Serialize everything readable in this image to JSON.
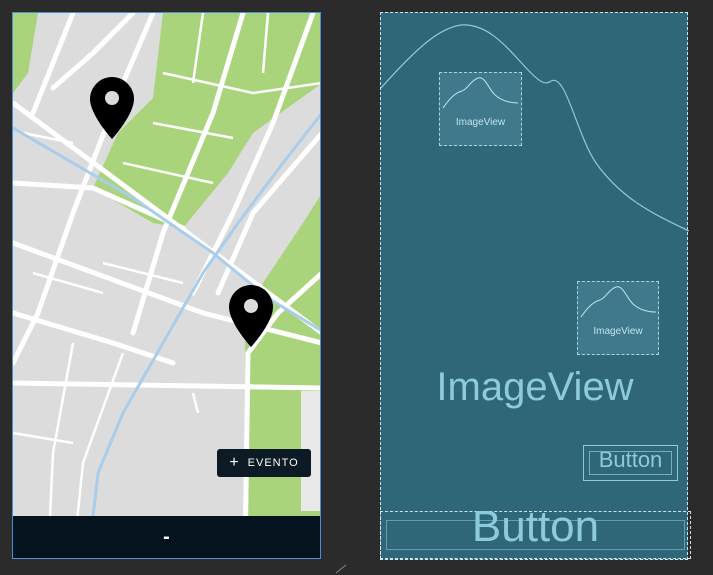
{
  "design_preview": {
    "event_button": {
      "icon": "plus-icon",
      "label": "EVENTO"
    },
    "bottom_bar": {
      "label": "-"
    },
    "map": {
      "pins": [
        "map-pin-icon",
        "map-pin-icon"
      ]
    },
    "colors": {
      "map_background": "#dcdcdc",
      "park": "#a9d47b",
      "river": "#a9cdea",
      "bar": "#04131e"
    }
  },
  "blueprint_preview": {
    "imageview_small_1": "ImageView",
    "imageview_small_2": "ImageView",
    "imageview_center": "ImageView",
    "button_small": "Button",
    "button_large": "Button",
    "colors": {
      "background": "#2f6678",
      "text": "#8ccbdc"
    }
  }
}
